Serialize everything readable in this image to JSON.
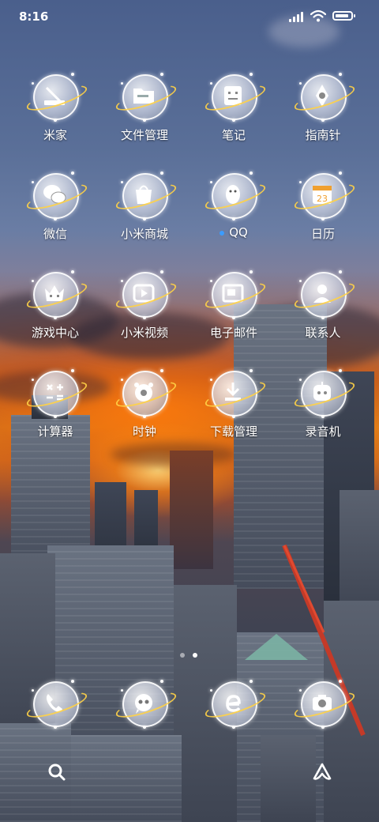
{
  "status": {
    "time": "8:16",
    "signal_icon": "signal-icon",
    "wifi_icon": "wifi-icon",
    "battery_icon": "battery-icon",
    "battery_level": 0.9
  },
  "apps": [
    {
      "label": "米家",
      "icon": "mijia-icon"
    },
    {
      "label": "文件管理",
      "icon": "folder-icon"
    },
    {
      "label": "笔记",
      "icon": "notes-icon"
    },
    {
      "label": "指南针",
      "icon": "compass-icon"
    },
    {
      "label": "微信",
      "icon": "wechat-icon"
    },
    {
      "label": "小米商城",
      "icon": "shopping-bag-icon"
    },
    {
      "label": "QQ",
      "icon": "qq-penguin-icon",
      "badge_dot": true
    },
    {
      "label": "日历",
      "icon": "calendar-icon",
      "calendar_day": "23"
    },
    {
      "label": "游戏中心",
      "icon": "game-crown-icon"
    },
    {
      "label": "小米视频",
      "icon": "video-play-icon"
    },
    {
      "label": "电子邮件",
      "icon": "email-icon"
    },
    {
      "label": "联系人",
      "icon": "contacts-icon"
    },
    {
      "label": "计算器",
      "icon": "calculator-icon"
    },
    {
      "label": "时钟",
      "icon": "clock-icon"
    },
    {
      "label": "下载管理",
      "icon": "download-icon"
    },
    {
      "label": "录音机",
      "icon": "recorder-icon"
    }
  ],
  "pager": {
    "pages": 2,
    "current": 2
  },
  "dock": [
    {
      "icon": "phone-icon"
    },
    {
      "icon": "messages-icon"
    },
    {
      "icon": "browser-icon"
    },
    {
      "icon": "camera-icon"
    }
  ],
  "bottom": {
    "left_icon": "search-icon",
    "right_icon": "ai-assistant-icon"
  },
  "colors": {
    "ring": "#ffd246",
    "badge": "#3b9cff",
    "accent_sunset": "#e58618"
  }
}
